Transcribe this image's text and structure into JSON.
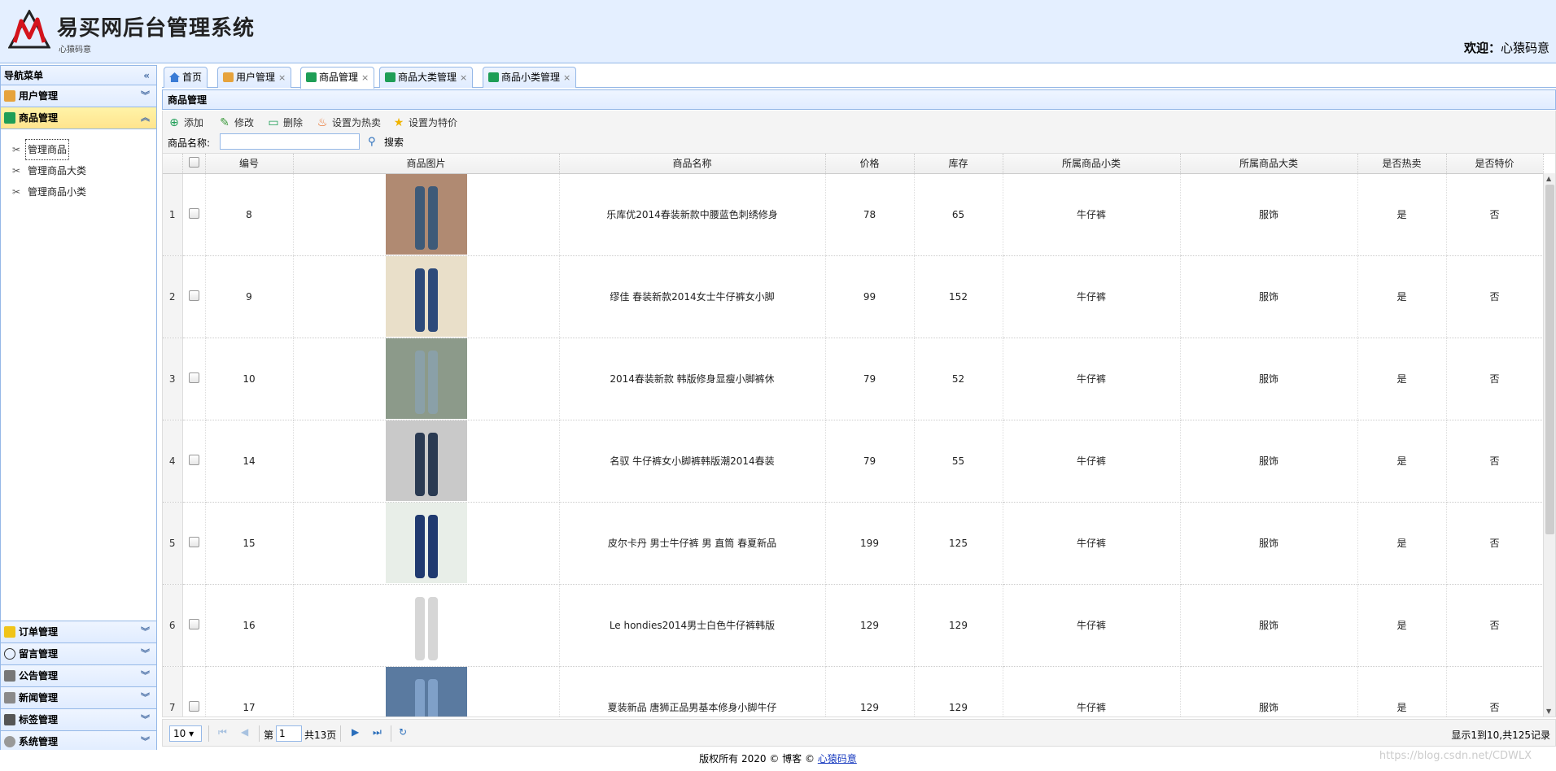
{
  "header": {
    "title": "易买网后台管理系统",
    "subtitle": "心猿码意",
    "welcome_label": "欢迎：",
    "welcome_user": "心猿码意"
  },
  "sidebar": {
    "title": "导航菜单",
    "groups": [
      {
        "label": "用户管理"
      },
      {
        "label": "商品管理"
      }
    ],
    "links": [
      "管理商品",
      "管理商品大类",
      "管理商品小类"
    ],
    "bottom_groups": [
      {
        "label": "订单管理"
      },
      {
        "label": "留言管理"
      },
      {
        "label": "公告管理"
      },
      {
        "label": "新闻管理"
      },
      {
        "label": "标签管理"
      },
      {
        "label": "系统管理"
      }
    ]
  },
  "tabs": [
    {
      "label": "首页"
    },
    {
      "label": "用户管理"
    },
    {
      "label": "商品管理"
    },
    {
      "label": "商品大类管理"
    },
    {
      "label": "商品小类管理"
    }
  ],
  "panel": {
    "title": "商品管理"
  },
  "toolbar": {
    "add": "添加",
    "edit": "修改",
    "delete": "删除",
    "set_hot": "设置为热卖",
    "set_special": "设置为特价"
  },
  "search": {
    "label": "商品名称:",
    "value": "",
    "button": "搜索"
  },
  "table": {
    "columns": [
      "编号",
      "商品图片",
      "商品名称",
      "价格",
      "库存",
      "所属商品小类",
      "所属商品大类",
      "是否热卖",
      "是否特价"
    ],
    "rows": [
      {
        "rn": "1",
        "id": "8",
        "name": "乐库优2014春装新款中腰蓝色刺绣修身",
        "price": "78",
        "stock": "65",
        "small": "牛仔裤",
        "big": "服饰",
        "hot": "是",
        "special": "否"
      },
      {
        "rn": "2",
        "id": "9",
        "name": "缪佳 春装新款2014女士牛仔裤女小脚",
        "price": "99",
        "stock": "152",
        "small": "牛仔裤",
        "big": "服饰",
        "hot": "是",
        "special": "否"
      },
      {
        "rn": "3",
        "id": "10",
        "name": "2014春装新款 韩版修身显瘦小脚裤休",
        "price": "79",
        "stock": "52",
        "small": "牛仔裤",
        "big": "服饰",
        "hot": "是",
        "special": "否"
      },
      {
        "rn": "4",
        "id": "14",
        "name": "名驭 牛仔裤女小脚裤韩版潮2014春装",
        "price": "79",
        "stock": "55",
        "small": "牛仔裤",
        "big": "服饰",
        "hot": "是",
        "special": "否"
      },
      {
        "rn": "5",
        "id": "15",
        "name": "皮尔卡丹 男士牛仔裤 男 直筒 春夏新品",
        "price": "199",
        "stock": "125",
        "small": "牛仔裤",
        "big": "服饰",
        "hot": "是",
        "special": "否"
      },
      {
        "rn": "6",
        "id": "16",
        "name": "Le hondies2014男士白色牛仔裤韩版",
        "price": "129",
        "stock": "129",
        "small": "牛仔裤",
        "big": "服饰",
        "hot": "是",
        "special": "否"
      },
      {
        "rn": "7",
        "id": "17",
        "name": "夏装新品 唐狮正品男基本修身小脚牛仔",
        "price": "129",
        "stock": "129",
        "small": "牛仔裤",
        "big": "服饰",
        "hot": "是",
        "special": "否"
      }
    ]
  },
  "pager": {
    "page_size": "10",
    "page_prefix": "第",
    "current_page": "1",
    "total_pages": "共13页",
    "info": "显示1到10,共125记录"
  },
  "footer": {
    "text": "版权所有 2020 © 博客 © ",
    "link": "心猿码意"
  },
  "watermark": "https://blog.csdn.net/CDWLX",
  "colors": {
    "border": "#95b8e7",
    "header_bg": "#e4efff",
    "active_group": "#ffe48d"
  }
}
